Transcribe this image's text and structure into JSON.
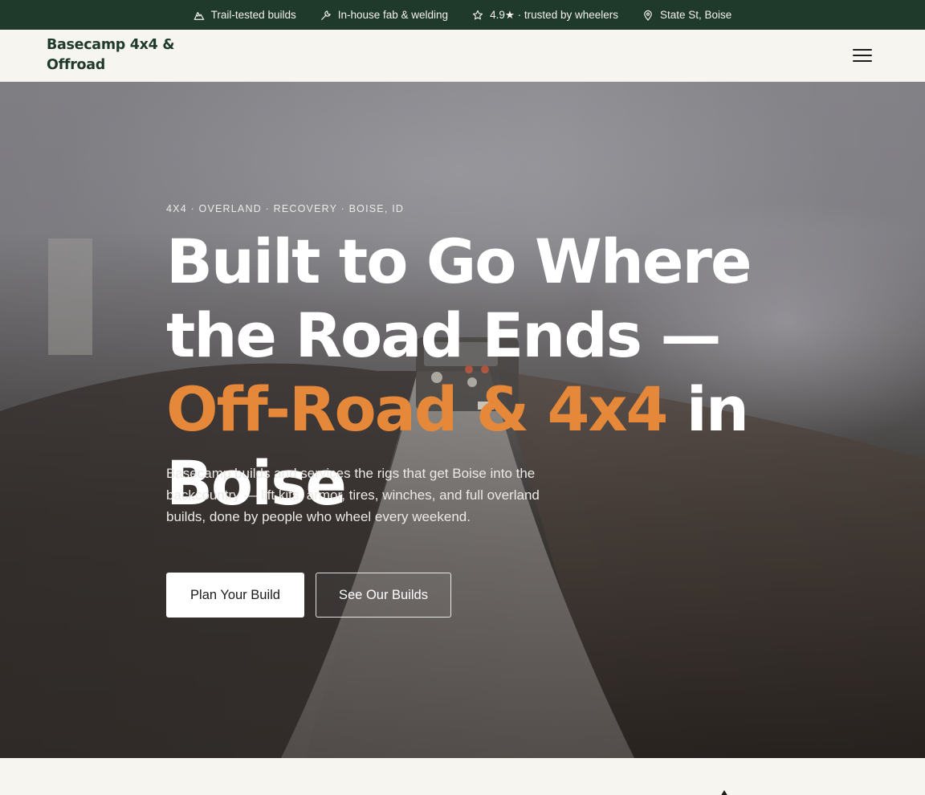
{
  "topbar": {
    "items": [
      {
        "icon": "mountain-icon",
        "label": "Trail-tested builds"
      },
      {
        "icon": "wrench-icon",
        "label": "In-house fab & welding"
      },
      {
        "icon": "star-icon",
        "label": "4.9★ · trusted by wheelers"
      },
      {
        "icon": "map-pin-icon",
        "label": "State St, Boise"
      }
    ]
  },
  "nav": {
    "brand": "Basecamp 4x4 & Offroad",
    "menu_icon": "hamburger-menu-icon"
  },
  "hero": {
    "eyebrow": "4X4 · OVERLAND · RECOVERY · BOISE, ID",
    "headline_start": "Built to Go Where the Road Ends — ",
    "headline_accent": "Off-Road & 4x4",
    "headline_end": " in Boise",
    "lede": "Basecamp builds and services the rigs that get Boise into the backcountry — lift kits, armor, tires, winches, and full overland builds, done by people who wheel every weekend.",
    "primary_cta": "Plan Your Build",
    "secondary_cta": "See Our Builds"
  },
  "colors": {
    "topbar_bg": "#1f3a2b",
    "brand": "#1f3a2b",
    "accent": "#e6883a",
    "page_bg": "#f7f5f0"
  }
}
